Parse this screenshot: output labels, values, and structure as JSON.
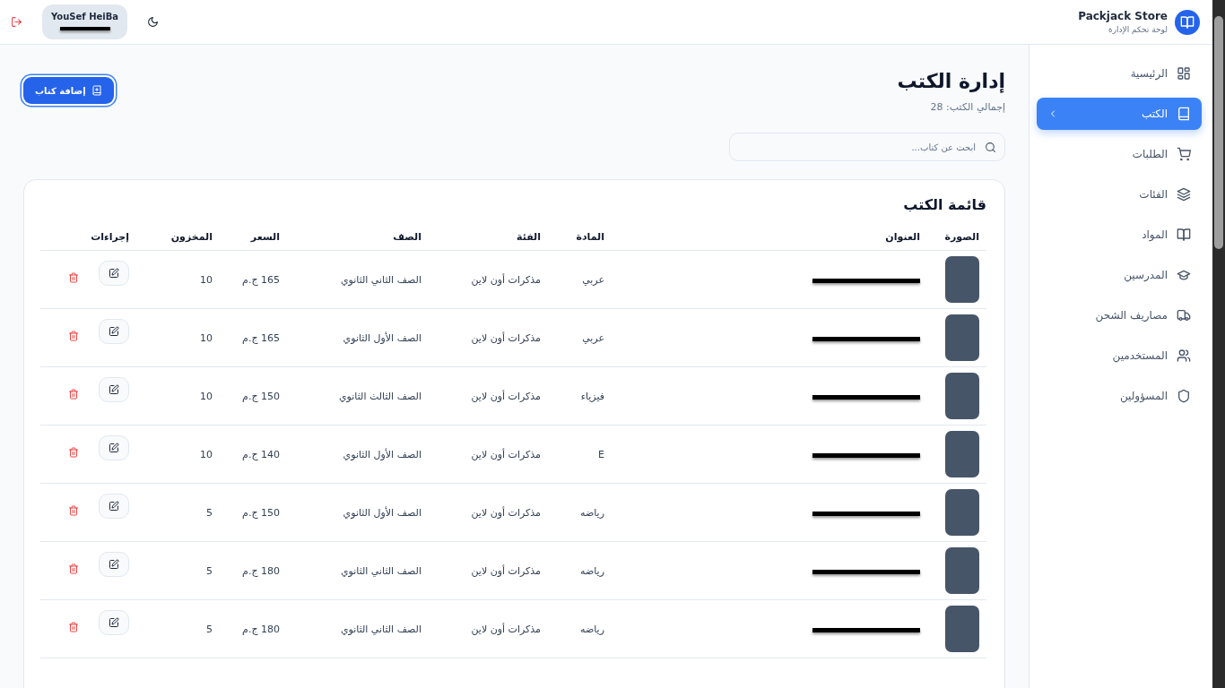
{
  "header": {
    "brand": "Packjack Store",
    "subtitle": "لوحة تحكم الإدارة",
    "user_name": "YouSef HeiBa"
  },
  "sidebar": {
    "items": [
      {
        "label": "الرئيسية",
        "selected": false
      },
      {
        "label": "الكتب",
        "selected": true
      },
      {
        "label": "الطلبات",
        "selected": false
      },
      {
        "label": "الفئات",
        "selected": false
      },
      {
        "label": "المواد",
        "selected": false
      },
      {
        "label": "المدرسين",
        "selected": false
      },
      {
        "label": "مصاريف الشحن",
        "selected": false
      },
      {
        "label": "المستخدمين",
        "selected": false
      },
      {
        "label": "المسؤولين",
        "selected": false
      }
    ]
  },
  "page": {
    "title": "إدارة الكتب",
    "total": "إجمالي الكتب: 28",
    "add_button": "إضافة كتاب",
    "search": {
      "placeholder": "ابحث عن كتاب..."
    }
  },
  "table": {
    "title": "قائمة الكتب",
    "columns": [
      "الصورة",
      "العنوان",
      "المادة",
      "الفئة",
      "الصف",
      "السعر",
      "المخزون",
      "إجراءات"
    ],
    "rows": [
      {
        "subject": "عربي",
        "category": "مذكرات أون لاين",
        "grade": "الصف الثاني الثانوي",
        "price": "165 ج.م",
        "stock": "10"
      },
      {
        "subject": "عربي",
        "category": "مذكرات أون لاين",
        "grade": "الصف الأول الثانوي",
        "price": "165 ج.م",
        "stock": "10"
      },
      {
        "subject": "فيزياء",
        "category": "مذكرات أون لاين",
        "grade": "الصف الثالث الثانوي",
        "price": "150 ج.م",
        "stock": "10"
      },
      {
        "subject": "E",
        "category": "مذكرات أون لاين",
        "grade": "الصف الأول الثانوي",
        "price": "140 ج.م",
        "stock": "10"
      },
      {
        "subject": "رياضه",
        "category": "مذكرات أون لاين",
        "grade": "الصف الأول الثانوي",
        "price": "150 ج.م",
        "stock": "5"
      },
      {
        "subject": "رياضه",
        "category": "مذكرات أون لاين",
        "grade": "الصف الثاني الثانوي",
        "price": "180 ج.م",
        "stock": "5"
      },
      {
        "subject": "رياضه",
        "category": "مذكرات أون لاين",
        "grade": "الصف الثاني الثانوي",
        "price": "180 ج.م",
        "stock": "5"
      }
    ]
  }
}
